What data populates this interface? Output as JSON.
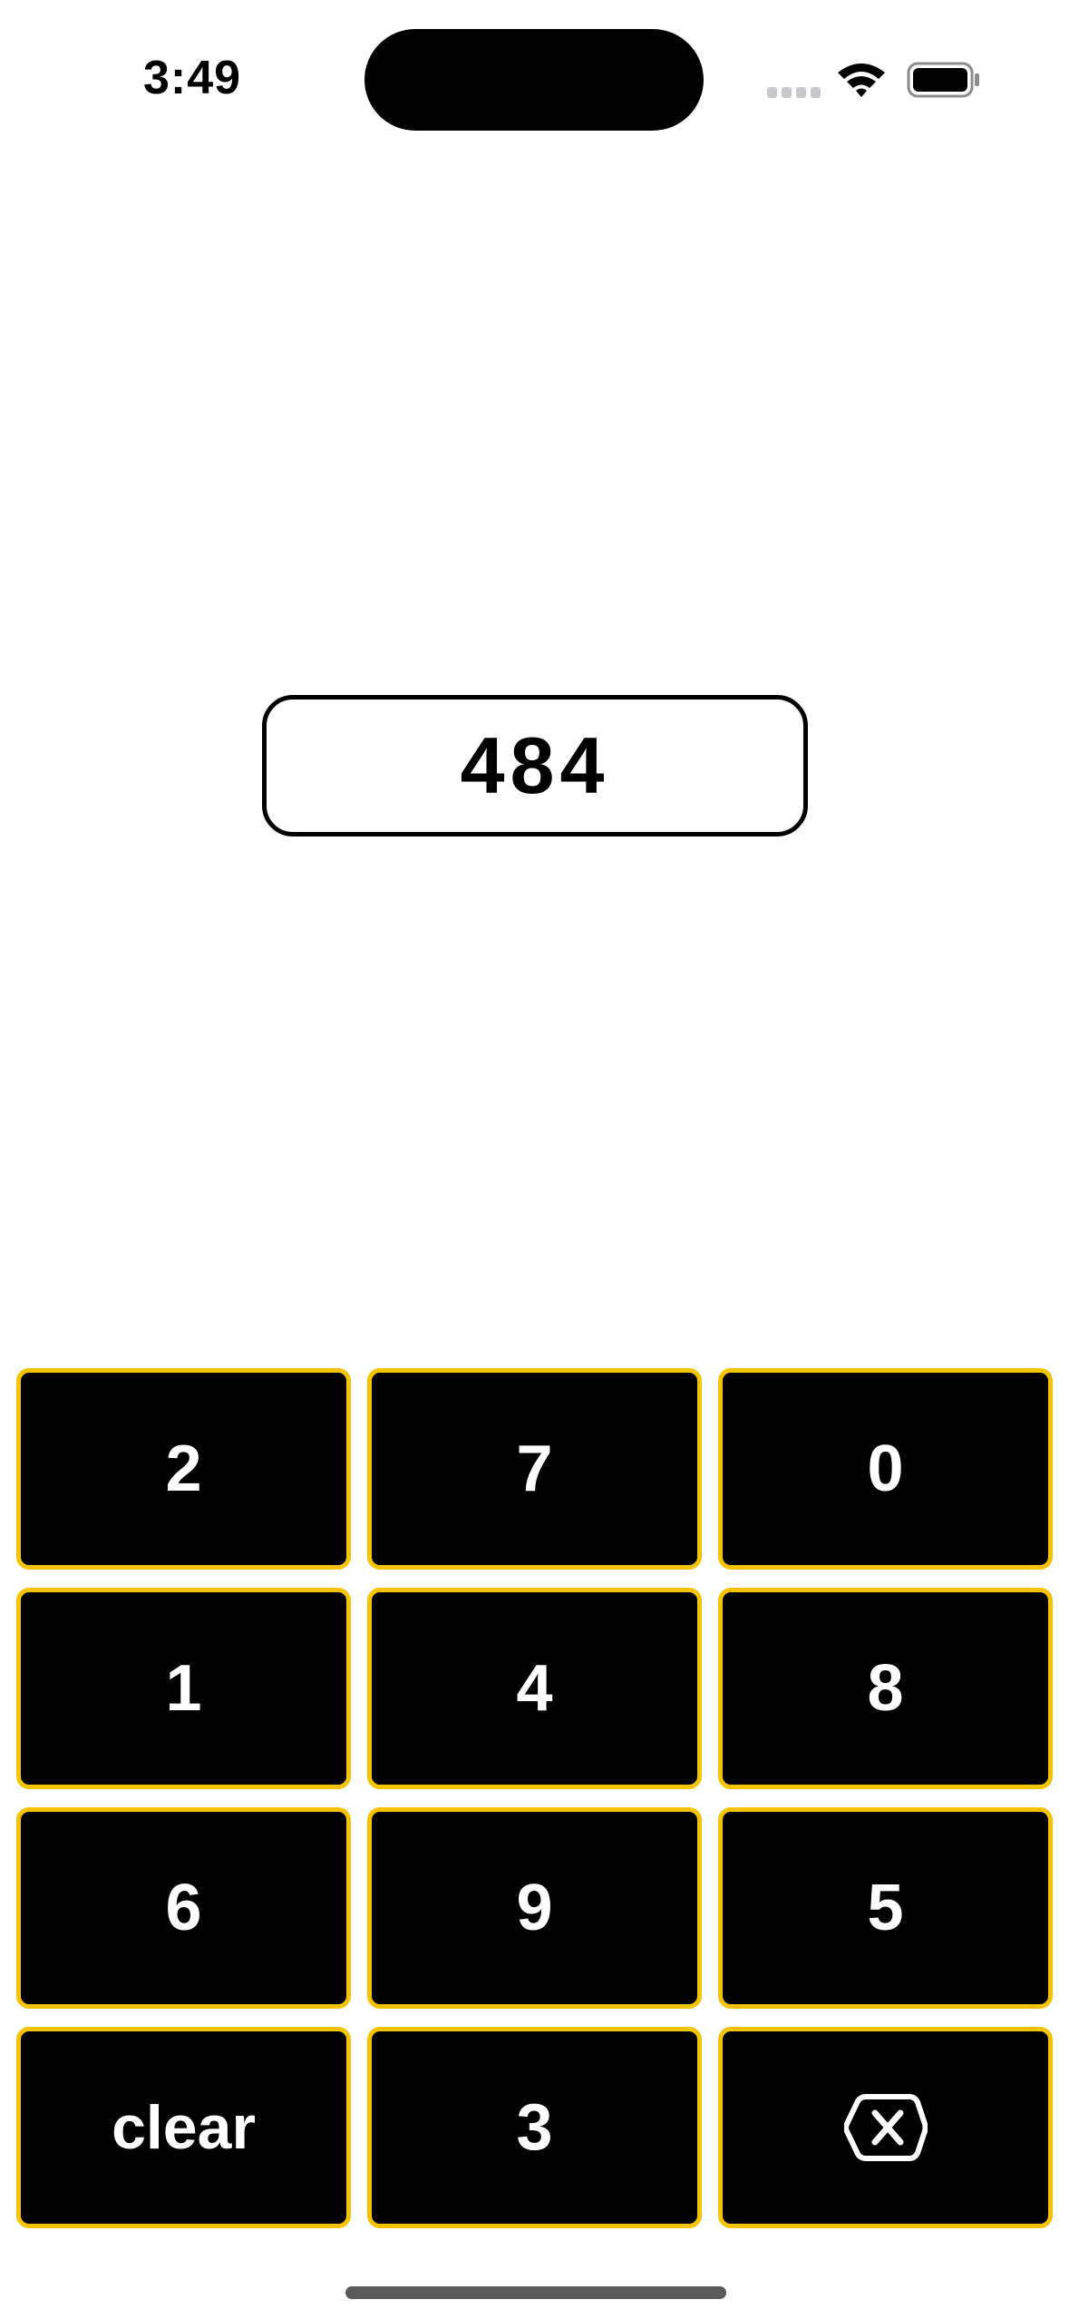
{
  "status_bar": {
    "time": "3:49",
    "icons": [
      "cellular-signal-icon",
      "wifi-icon",
      "battery-icon"
    ]
  },
  "display": {
    "value": "484"
  },
  "keypad": {
    "keys": [
      {
        "label": "2"
      },
      {
        "label": "7"
      },
      {
        "label": "0"
      },
      {
        "label": "1"
      },
      {
        "label": "4"
      },
      {
        "label": "8"
      },
      {
        "label": "6"
      },
      {
        "label": "9"
      },
      {
        "label": "5"
      },
      {
        "label": "clear"
      },
      {
        "label": "3"
      },
      {
        "label": "",
        "icon": "delete-backward-icon"
      }
    ]
  },
  "colors": {
    "key_background": "#000000",
    "key_border": "#f5c400",
    "key_text": "#ffffff",
    "display_border": "#000000"
  }
}
